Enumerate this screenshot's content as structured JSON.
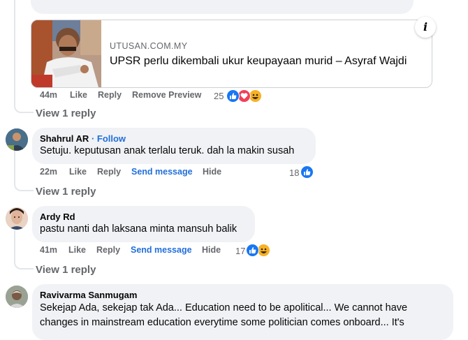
{
  "preview": {
    "domain": "UTUSAN.COM.MY",
    "title": "UPSR perlu dikembali ukur keupayaan murid – Asyraf Wajdi",
    "info_label": "i"
  },
  "first_comment_actions": {
    "time": "44m",
    "like": "Like",
    "reply": "Reply",
    "remove_preview": "Remove Preview",
    "reaction_count": "25"
  },
  "view_reply_label": "View 1 reply",
  "comments": [
    {
      "author": "Shahrul AR",
      "follow": "· Follow",
      "text": "Setuju. keputusan anak terlalu teruk. dah la makin susah",
      "time": "22m",
      "like": "Like",
      "reply": "Reply",
      "send": "Send message",
      "hide": "Hide",
      "reaction_count": "18"
    },
    {
      "author": "Ardy Rd",
      "text": "pastu nanti dah laksana minta mansuh balik",
      "time": "41m",
      "like": "Like",
      "reply": "Reply",
      "send": "Send message",
      "hide": "Hide",
      "reaction_count": "17"
    },
    {
      "author": "Ravivarma Sanmugam",
      "text_line1": "Sekejap Ada, sekejap tak Ada... Education need to be apolitical... We cannot have",
      "text_line2": "changes in mainstream education everytime some politician comes onboard... It's"
    }
  ],
  "icons": {
    "like": "thumbs-up-icon",
    "love": "heart-icon",
    "haha": "laughing-face-icon",
    "info": "info-icon"
  },
  "colors": {
    "link_blue": "#216fdb",
    "bubble_bg": "#f0f2f5",
    "meta_gray": "#65676b",
    "love_red": "#f33e58",
    "haha_yellow": "#f7b125"
  }
}
